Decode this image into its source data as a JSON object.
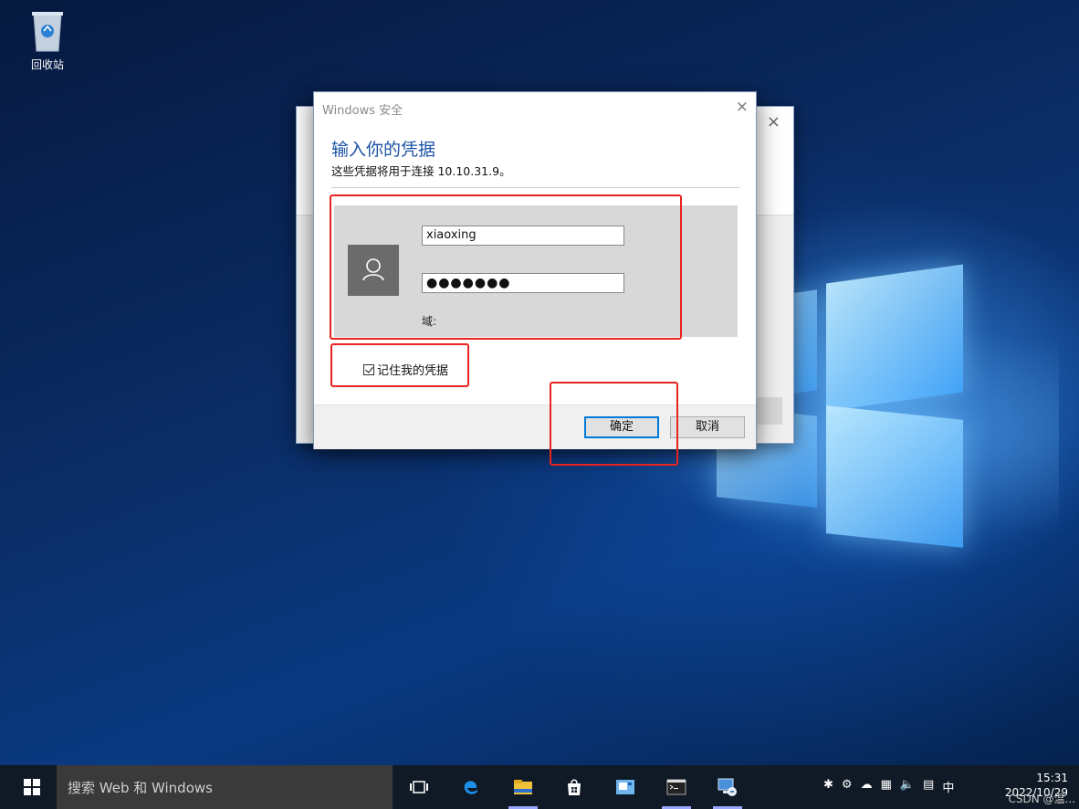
{
  "desktop": {
    "recycle_bin_label": "回收站"
  },
  "dialog": {
    "window_title": "Windows 安全",
    "close_glyph": "×",
    "heading": "输入你的凭据",
    "subtitle": "这些凭据将用于连接 10.10.31.9。",
    "username_value": "xiaoxing",
    "password_mask": "●●●●●●●",
    "domain_label": "域:",
    "remember_label": "记住我的凭据",
    "ok_label": "确定",
    "cancel_label": "取消"
  },
  "background_window": {
    "close_glyph": "×"
  },
  "taskbar": {
    "search_placeholder": "搜索 Web 和 Windows",
    "tray_ime": "中",
    "clock_time": "15:31",
    "clock_date": "2022/10/29",
    "watermark": "CSDN @温..."
  },
  "colors": {
    "accent_blue": "#1d54a6",
    "annotation_red": "#e8231f",
    "taskbar_bg": "#101a26"
  }
}
